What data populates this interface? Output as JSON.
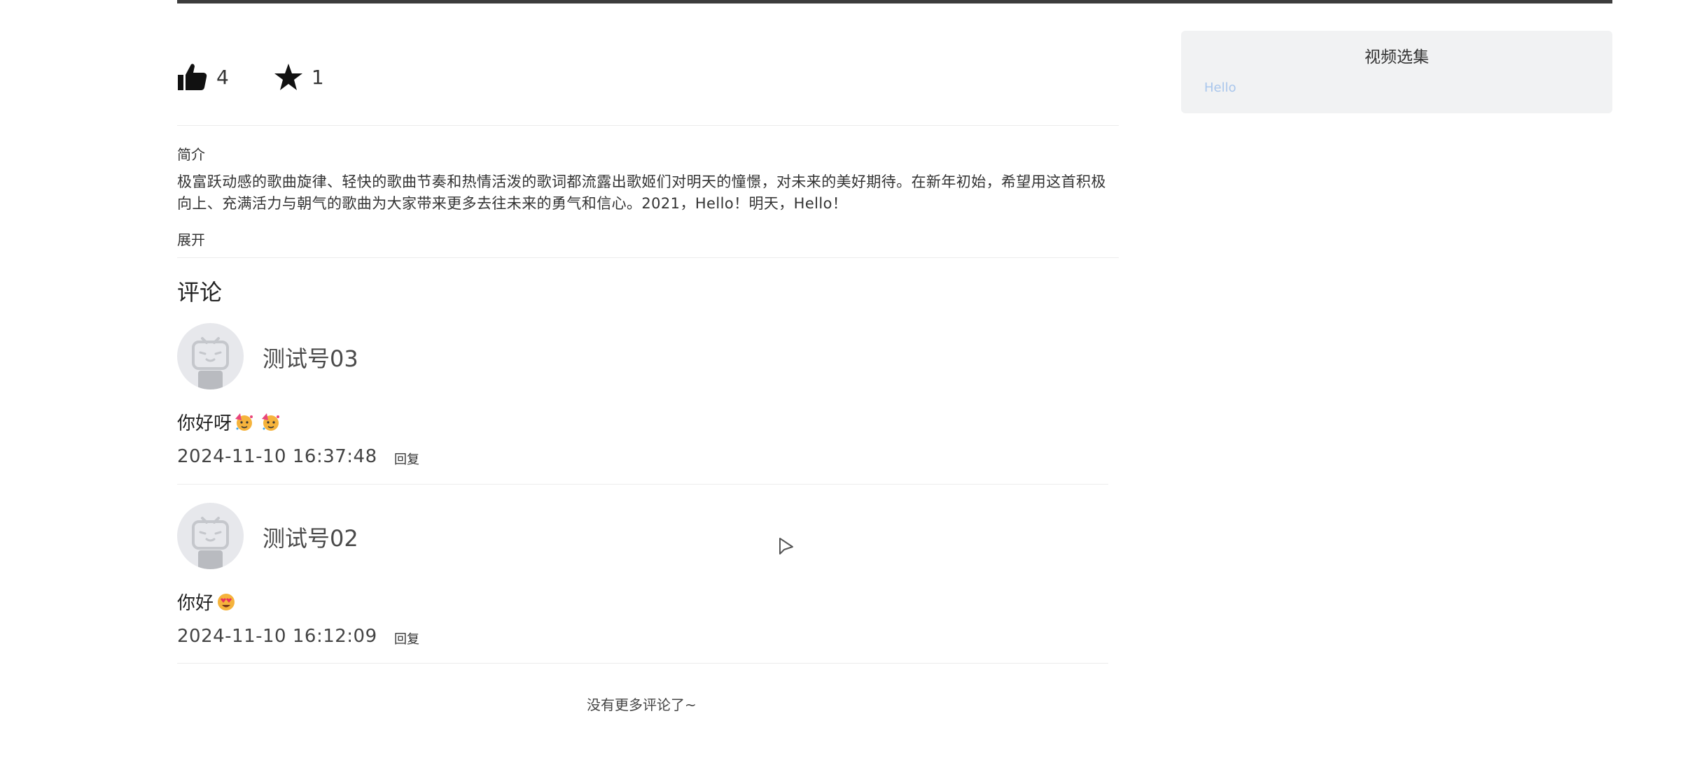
{
  "actions": {
    "like_count": "4",
    "favorite_count": "1"
  },
  "intro": {
    "label": "简介",
    "text": "极富跃动感的歌曲旋律、轻快的歌曲节奏和热情活泼的歌词都流露出歌姬们对明天的憧憬，对未来的美好期待。在新年初始，希望用这首积极向上、充满活力与朝气的歌曲为大家带来更多去往未来的勇气和信心。2021，Hello！明天，Hello！",
    "expand_label": "展开"
  },
  "comments": {
    "title": "评论",
    "items": [
      {
        "username": "测试号03",
        "text": "你好呀",
        "emojis": [
          "party-face",
          "party-face"
        ],
        "time": "2024-11-10 16:37:48",
        "reply_label": "回复"
      },
      {
        "username": "测试号02",
        "text": "你好",
        "emojis": [
          "heart-eyes"
        ],
        "time": "2024-11-10 16:12:09",
        "reply_label": "回复"
      }
    ],
    "no_more_text": "没有更多评论了~"
  },
  "sidebar": {
    "title": "视频选集",
    "items": [
      "Hello"
    ]
  },
  "colors": {
    "top_bar": "#3d3d3d",
    "sidebar_bg": "#f1f2f3",
    "sidebar_link": "#a9c6ec",
    "avatar_bg": "#e7e8ec"
  }
}
